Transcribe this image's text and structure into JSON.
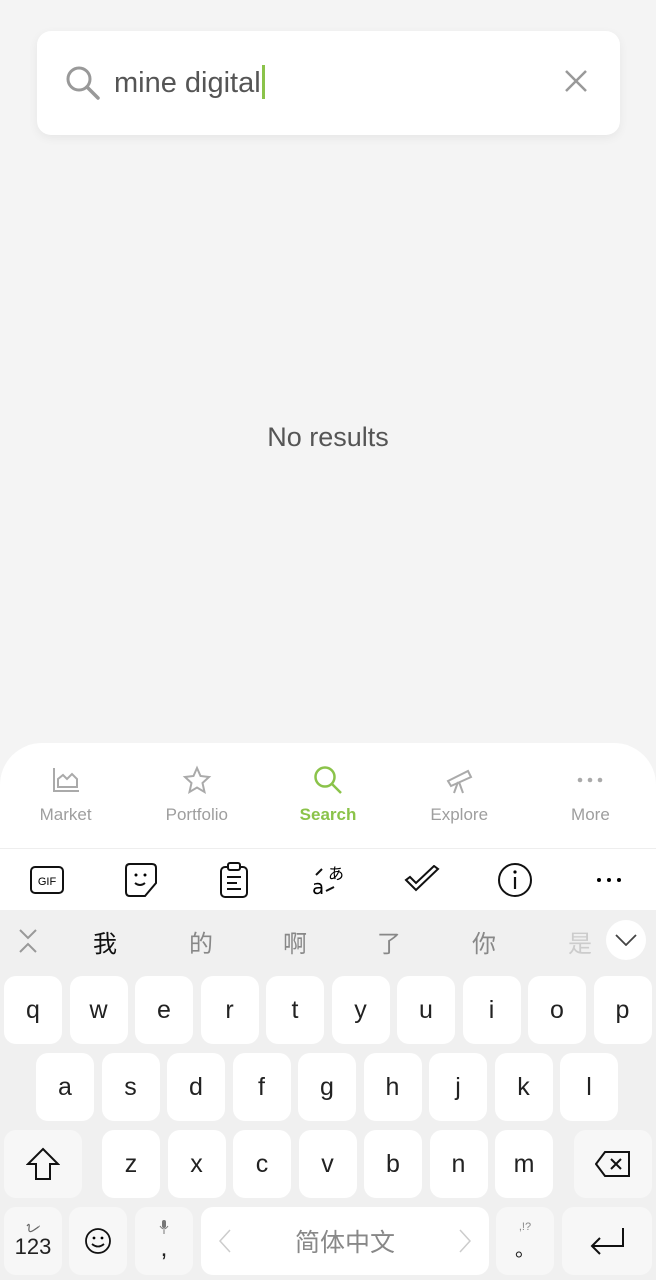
{
  "search": {
    "query": "mine digital",
    "icon": "search-icon",
    "clear_icon": "close-icon"
  },
  "empty_state": "No results",
  "nav": {
    "active_color": "#8bc34a",
    "items": [
      {
        "label": "Market",
        "icon": "chart-area-icon"
      },
      {
        "label": "Portfolio",
        "icon": "star-icon"
      },
      {
        "label": "Search",
        "icon": "search-icon",
        "active": true
      },
      {
        "label": "Explore",
        "icon": "telescope-icon"
      },
      {
        "label": "More",
        "icon": "more-dots-icon"
      }
    ]
  },
  "keyboard": {
    "toolbar": [
      "gif-icon",
      "sticker-icon",
      "clipboard-icon",
      "translate-icon",
      "spellcheck-icon",
      "info-icon",
      "more-icon"
    ],
    "gif_label": "GIF",
    "candidates": [
      "我",
      "的",
      "啊",
      "了",
      "你",
      "是"
    ],
    "rows": [
      [
        "q",
        "w",
        "e",
        "r",
        "t",
        "y",
        "u",
        "i",
        "o",
        "p"
      ],
      [
        "a",
        "s",
        "d",
        "f",
        "g",
        "h",
        "j",
        "k",
        "l"
      ],
      [
        "z",
        "x",
        "c",
        "v",
        "b",
        "n",
        "m"
      ]
    ],
    "num_label": "123",
    "comma": ",",
    "space_label": "简体中文",
    "punct_top": ",!?",
    "punct_main": "。"
  }
}
